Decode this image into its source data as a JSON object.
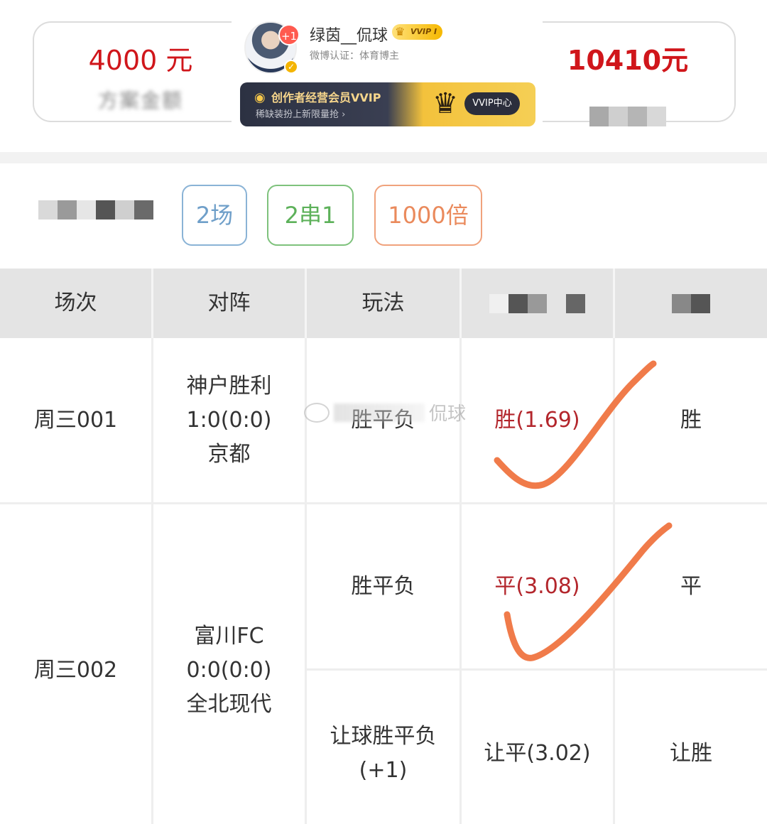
{
  "summary": {
    "left_amount": "4000 元",
    "left_label": "方案金额",
    "right_amount": "10410元"
  },
  "profile": {
    "notification_count": "+1",
    "username": "绿茵__侃球",
    "vvip_badge": "VVIP I",
    "verification": "微博认证：体育博主",
    "banner_title": "创作者经营会员VVIP",
    "banner_subtitle": "稀缺装扮上新限量抢 ›",
    "vip_center": "VVIP中心"
  },
  "tags": {
    "matches": "2场",
    "combo": "2串1",
    "multiplier": "1000倍"
  },
  "table": {
    "headers": [
      "场次",
      "对阵",
      "玩法"
    ],
    "rows": [
      {
        "match_no": "周三001",
        "home": "神户胜利",
        "score": "1:0(0:0)",
        "away": "京都",
        "plays": [
          {
            "type": "胜平负",
            "pick": "胜(1.69)",
            "result": "胜"
          }
        ]
      },
      {
        "match_no": "周三002",
        "home": "富川FC",
        "score": "0:0(0:0)",
        "away": "全北现代",
        "plays": [
          {
            "type": "胜平负",
            "pick": "平(3.08)",
            "result": "平"
          },
          {
            "type_line1": "让球胜平负",
            "type_line2": "(+1)",
            "pick": "让平(3.02)",
            "result": "让胜"
          }
        ]
      }
    ]
  },
  "watermark": "侃球",
  "colors": {
    "amount_red": "#d0161b",
    "pick_red": "#b3262c",
    "tag_blue": "#6f9fc9",
    "tag_green": "#5db15a",
    "tag_orange": "#ea8a5c",
    "check_orange": "#f07b4a",
    "header_gray": "#e4e4e4"
  }
}
